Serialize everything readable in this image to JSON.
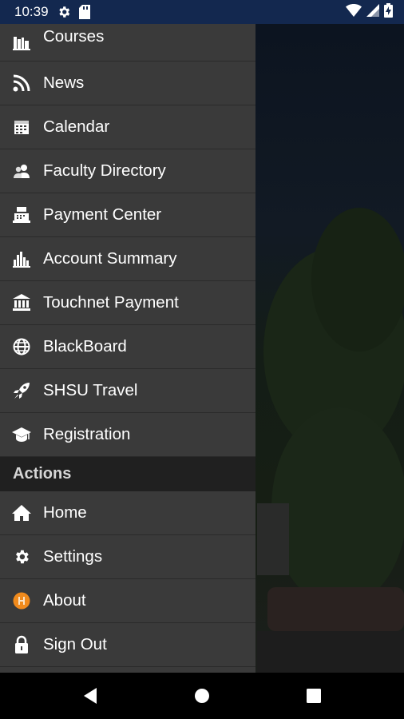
{
  "status_bar": {
    "time": "10:39",
    "left_icons": [
      "gear-icon",
      "sd-card-icon"
    ],
    "right_icons": [
      "wifi-icon",
      "signal-icon",
      "battery-charging-icon"
    ]
  },
  "drawer": {
    "items": [
      {
        "label": "Courses",
        "icon": "library-icon"
      },
      {
        "label": "News",
        "icon": "rss-icon"
      },
      {
        "label": "Calendar",
        "icon": "calendar-icon"
      },
      {
        "label": "Faculty Directory",
        "icon": "people-icon"
      },
      {
        "label": "Payment Center",
        "icon": "cash-register-icon"
      },
      {
        "label": "Account Summary",
        "icon": "bar-chart-icon"
      },
      {
        "label": "Touchnet Payment",
        "icon": "bank-icon"
      },
      {
        "label": "BlackBoard",
        "icon": "globe-icon"
      },
      {
        "label": "SHSU Travel",
        "icon": "rocket-icon"
      },
      {
        "label": "Registration",
        "icon": "graduation-cap-icon"
      }
    ],
    "actions_header": "Actions",
    "actions": [
      {
        "label": "Home",
        "icon": "home-icon"
      },
      {
        "label": "Settings",
        "icon": "gear-icon"
      },
      {
        "label": "About",
        "icon": "shsu-logo-icon"
      },
      {
        "label": "Sign Out",
        "icon": "lock-icon"
      }
    ]
  },
  "nav_bar": {
    "buttons": [
      "back-icon",
      "home-circle-icon",
      "recents-icon"
    ]
  },
  "colors": {
    "status_bar": "#13284f",
    "drawer_bg": "#3a3a3a",
    "section_header_bg": "#202020",
    "about_logo": "#f08a1c"
  }
}
